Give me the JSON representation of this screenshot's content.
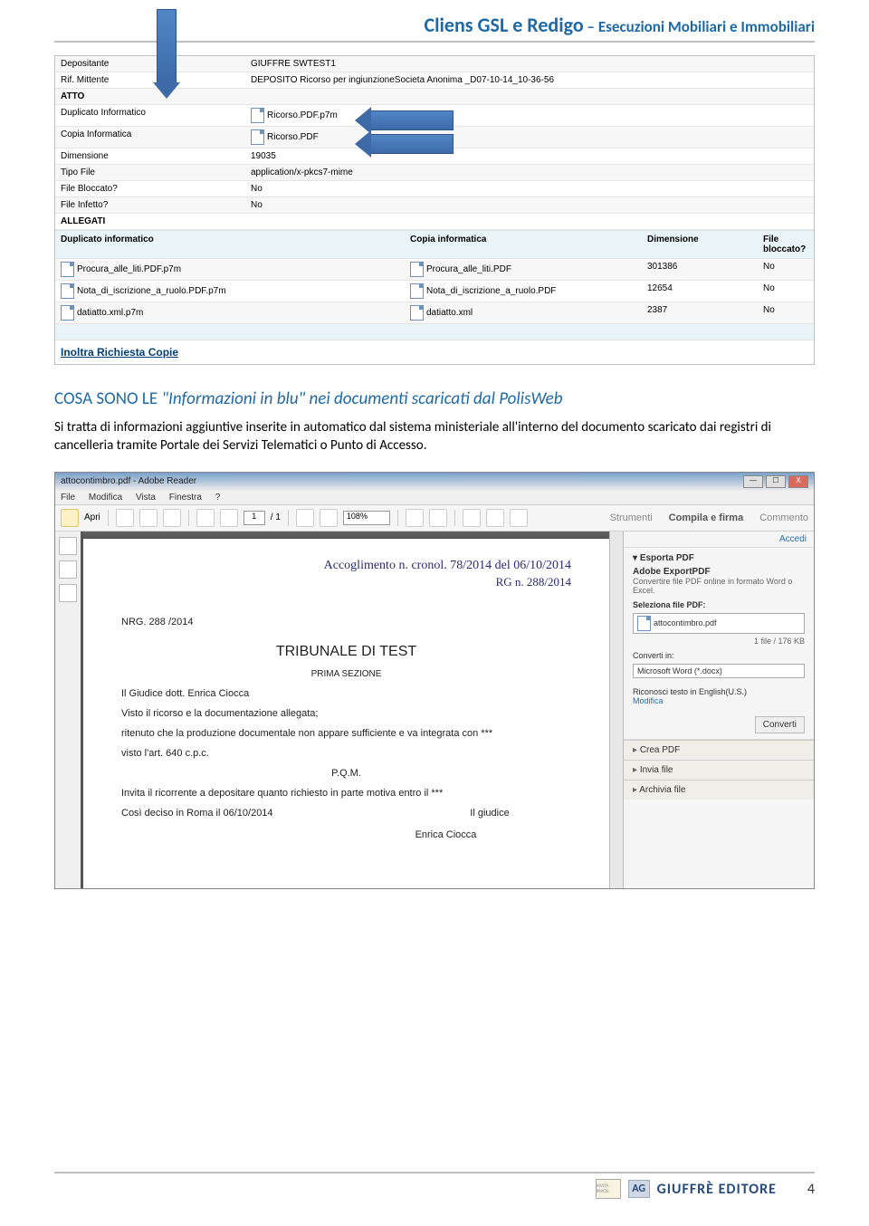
{
  "header": {
    "brand": "Cliens GSL e Redigo",
    "subtitle": " – Esecuzioni Mobiliari e Immobiliari"
  },
  "table1": {
    "rows": [
      {
        "l": "Depositante",
        "v": "GIUFFRE SWTEST1"
      },
      {
        "l": "Rif. Mittente",
        "v": "DEPOSITO Ricorso per ingiunzioneSocieta Anonima _D07-10-14_10-36-56"
      },
      {
        "l": "ATTO",
        "v": "",
        "bold": true
      },
      {
        "l": "Duplicato Informatico",
        "v": "Ricorso.PDF.p7m",
        "icon": true
      },
      {
        "l": "Copia Informatica",
        "v": "Ricorso.PDF",
        "icon": true
      },
      {
        "l": "Dimensione",
        "v": "19035"
      },
      {
        "l": "Tipo File",
        "v": "application/x-pkcs7-mime"
      },
      {
        "l": "File Bloccato?",
        "v": "No"
      },
      {
        "l": "File Infetto?",
        "v": "No"
      },
      {
        "l": "ALLEGATI",
        "v": "",
        "bold": true
      }
    ],
    "cols": [
      "Duplicato informatico",
      "Copia informatica",
      "Dimensione",
      "File bloccato?"
    ],
    "data": [
      {
        "a": "Procura_alle_liti.PDF.p7m",
        "b": "Procura_alle_liti.PDF",
        "c": "301386",
        "d": "No"
      },
      {
        "a": "Nota_di_iscrizione_a_ruolo.PDF.p7m",
        "b": "Nota_di_iscrizione_a_ruolo.PDF",
        "c": "12654",
        "d": "No"
      },
      {
        "a": "datiatto.xml.p7m",
        "b": "datiatto.xml",
        "c": "2387",
        "d": "No"
      }
    ],
    "footer": "Inoltra Richiesta Copie"
  },
  "section": {
    "title_pre": "COSA SONO LE ",
    "title_q": "\"Informazioni in blu\"",
    "title_post": " nei documenti scaricati dal PolisWeb",
    "para": "Si tratta di informazioni aggiuntive inserite in automatico dal sistema ministeriale all'interno del documento scaricato dai registri di cancelleria tramite Portale dei Servizi Telematici o Punto di Accesso."
  },
  "reader": {
    "title": "attocontimbro.pdf - Adobe Reader",
    "menu": [
      "File",
      "Modifica",
      "Vista",
      "Finestra",
      "?"
    ],
    "open": "Apri",
    "page": "1",
    "pagetot": "/ 1",
    "zoom": "108%",
    "tabs": [
      "Strumenti",
      "Compila e firma",
      "Commento"
    ],
    "accedi": "Accedi",
    "export": {
      "title": "Esporta PDF",
      "sub": "Adobe ExportPDF",
      "desc": "Convertire file PDF online in formato Word o Excel.",
      "sel_label": "Seleziona file PDF:",
      "sel": "attocontimbro.pdf",
      "count": "1 file / 176 KB",
      "conv_label": "Converti in:",
      "conv_sel": "Microsoft Word (*.docx)",
      "rec": "Riconosci testo in English(U.S.)",
      "mod": "Modifica",
      "btn": "Converti"
    },
    "links": [
      "Crea PDF",
      "Invia file",
      "Archivia file"
    ]
  },
  "doc": {
    "stamp1": "Accoglimento n. cronol. 78/2014 del 06/10/2014",
    "stamp2": "RG n. 288/2014",
    "nrg": "NRG. 288 /2014",
    "court": "TRIBUNALE DI TEST",
    "sez": "PRIMA SEZIONE",
    "p1": "Il Giudice dott. Enrica  Ciocca",
    "p2": "Visto il ricorso e la documentazione allegata;",
    "p3": "ritenuto che la produzione documentale non appare sufficiente e va integrata con ***",
    "p4": "visto l'art. 640 c.p.c.",
    "pqm": "P.Q.M.",
    "p5": "Invita il ricorrente a depositare quanto richiesto in parte motiva entro il ***",
    "p6a": "Così deciso in Roma il 06/10/2014",
    "p6b": "Il giudice",
    "p7": "Enrica  Ciocca"
  },
  "footer": {
    "mp": "MVLTA PAVCIS",
    "ag": "AG",
    "ed": "GIUFFRÈ EDITORE",
    "page": "4"
  }
}
